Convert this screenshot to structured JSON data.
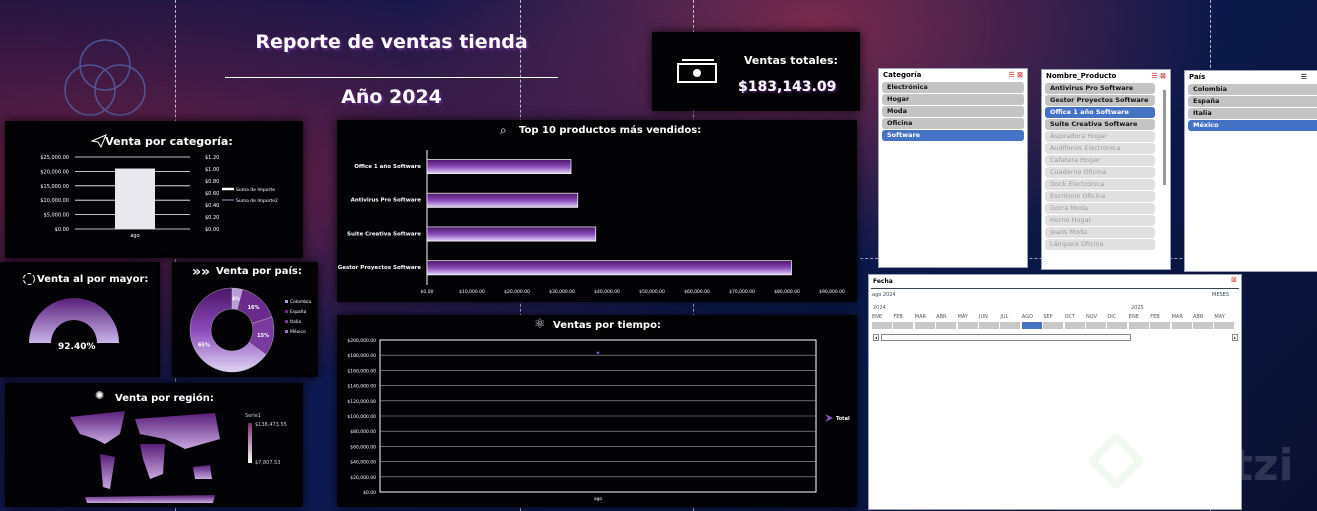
{
  "header": {
    "title": "Reporte de ventas tienda",
    "year": "Año 2024"
  },
  "kpi": {
    "label": "Ventas totales:",
    "value": "$183,143.09"
  },
  "category": {
    "title": "Venta por categoría:",
    "legend": [
      "Suma de Importe",
      "Suma de Importe2"
    ]
  },
  "wholesale": {
    "title": "Venta al por mayor:",
    "value": "92.40%"
  },
  "country": {
    "title": "Venta por país:"
  },
  "region": {
    "title": "Venta por región:",
    "legend_title": "Serie1",
    "max": "$138,473.55",
    "min": "$7,807.53"
  },
  "top10": {
    "title": "Top 10 productos más vendidos:"
  },
  "time": {
    "title": "Ventas por tiempo:",
    "legend": "Total"
  },
  "colors": {
    "accent": "#6a2a8c",
    "selected": "#4472c4",
    "bar_light": "#d8c8f0"
  },
  "chart_data": [
    {
      "type": "bar",
      "title": "Venta por categoría:",
      "categories": [
        "ago"
      ],
      "series": [
        {
          "name": "Suma de Importe",
          "values": [
            21000
          ]
        }
      ],
      "ylim": [
        0,
        25000
      ],
      "yticks": [
        "$0.00",
        "$5,000.00",
        "$10,000.00",
        "$15,000.00",
        "$20,000.00",
        "$25,000.00"
      ],
      "y2ticks": [
        "$0.00",
        "$0.20",
        "$0.40",
        "$0.60",
        "$0.80",
        "$1.00",
        "$1.20"
      ],
      "legend": "right",
      "grid": true
    },
    {
      "type": "pie",
      "title": "Venta por país:",
      "categories": [
        "Colombia",
        "España",
        "Italia",
        "México"
      ],
      "values": [
        4,
        16,
        15,
        65
      ],
      "labels": [
        "4%",
        "16%",
        "15%",
        "65%"
      ],
      "legend": "right"
    },
    {
      "type": "bar",
      "orientation": "horizontal",
      "title": "Top 10 productos más vendidos:",
      "categories": [
        "Office 1 año Software",
        "Antivirus Pro Software",
        "Suite Creativa Software",
        "Gestor Proyectos Software"
      ],
      "values": [
        32000,
        33500,
        37500,
        81000
      ],
      "xlim": [
        0,
        90000
      ],
      "xticks": [
        "$0.00",
        "$10,000.00",
        "$20,000.00",
        "$30,000.00",
        "$40,000.00",
        "$50,000.00",
        "$60,000.00",
        "$70,000.00",
        "$80,000.00",
        "$90,000.00"
      ]
    },
    {
      "type": "line",
      "title": "Ventas por tiempo:",
      "categories": [
        "ago"
      ],
      "series": [
        {
          "name": "Total",
          "values": [
            183143.09
          ]
        }
      ],
      "ylim": [
        0,
        200000
      ],
      "yticks": [
        "$0.00",
        "$20,000.00",
        "$40,000.00",
        "$60,000.00",
        "$80,000.00",
        "$100,000.00",
        "$120,000.00",
        "$140,000.00",
        "$160,000.00",
        "$180,000.00",
        "$200,000.00"
      ],
      "grid": true,
      "legend": "right"
    }
  ],
  "slicers": {
    "categoria": {
      "title": "Categoría",
      "items": [
        {
          "label": "Electrónica",
          "state": "on"
        },
        {
          "label": "Hogar",
          "state": "on"
        },
        {
          "label": "Moda",
          "state": "on"
        },
        {
          "label": "Oficina",
          "state": "on"
        },
        {
          "label": "Software",
          "state": "selected"
        }
      ]
    },
    "producto": {
      "title": "Nombre_Producto",
      "items": [
        {
          "label": "Antivirus Pro Software",
          "state": "on"
        },
        {
          "label": "Gestor Proyectos Software",
          "state": "on"
        },
        {
          "label": "Office 1 año Software",
          "state": "selected"
        },
        {
          "label": "Suite Creativa Software",
          "state": "on"
        },
        {
          "label": "Aspiradora Hogar",
          "state": "dim"
        },
        {
          "label": "Audífonos Electrónica",
          "state": "dim"
        },
        {
          "label": "Cafetera Hogar",
          "state": "dim"
        },
        {
          "label": "Cuaderno Oficina",
          "state": "dim"
        },
        {
          "label": "Dock Electrónica",
          "state": "dim"
        },
        {
          "label": "Escritorio Oficina",
          "state": "dim"
        },
        {
          "label": "Gorra Moda",
          "state": "dim"
        },
        {
          "label": "Horno Hogar",
          "state": "dim"
        },
        {
          "label": "Jeans Moda",
          "state": "dim"
        },
        {
          "label": "Lámpara Oficina",
          "state": "dim"
        }
      ]
    },
    "pais": {
      "title": "País",
      "items": [
        {
          "label": "Colombia",
          "state": "on"
        },
        {
          "label": "España",
          "state": "on"
        },
        {
          "label": "Italia",
          "state": "on"
        },
        {
          "label": "México",
          "state": "selected"
        }
      ]
    }
  },
  "timeline": {
    "title": "Fecha",
    "range": "ago 2024",
    "level": "MESES",
    "year1": "2024",
    "year2": "2025",
    "months": [
      "ENE",
      "FEB",
      "MAR",
      "ABR",
      "MAY",
      "JUN",
      "JUL",
      "AGO",
      "SEP",
      "OCT",
      "NOV",
      "DIC",
      "ENE",
      "FEB",
      "MAR",
      "ABR",
      "MAY"
    ],
    "selected_index": 7
  },
  "watermark": "Platzi"
}
